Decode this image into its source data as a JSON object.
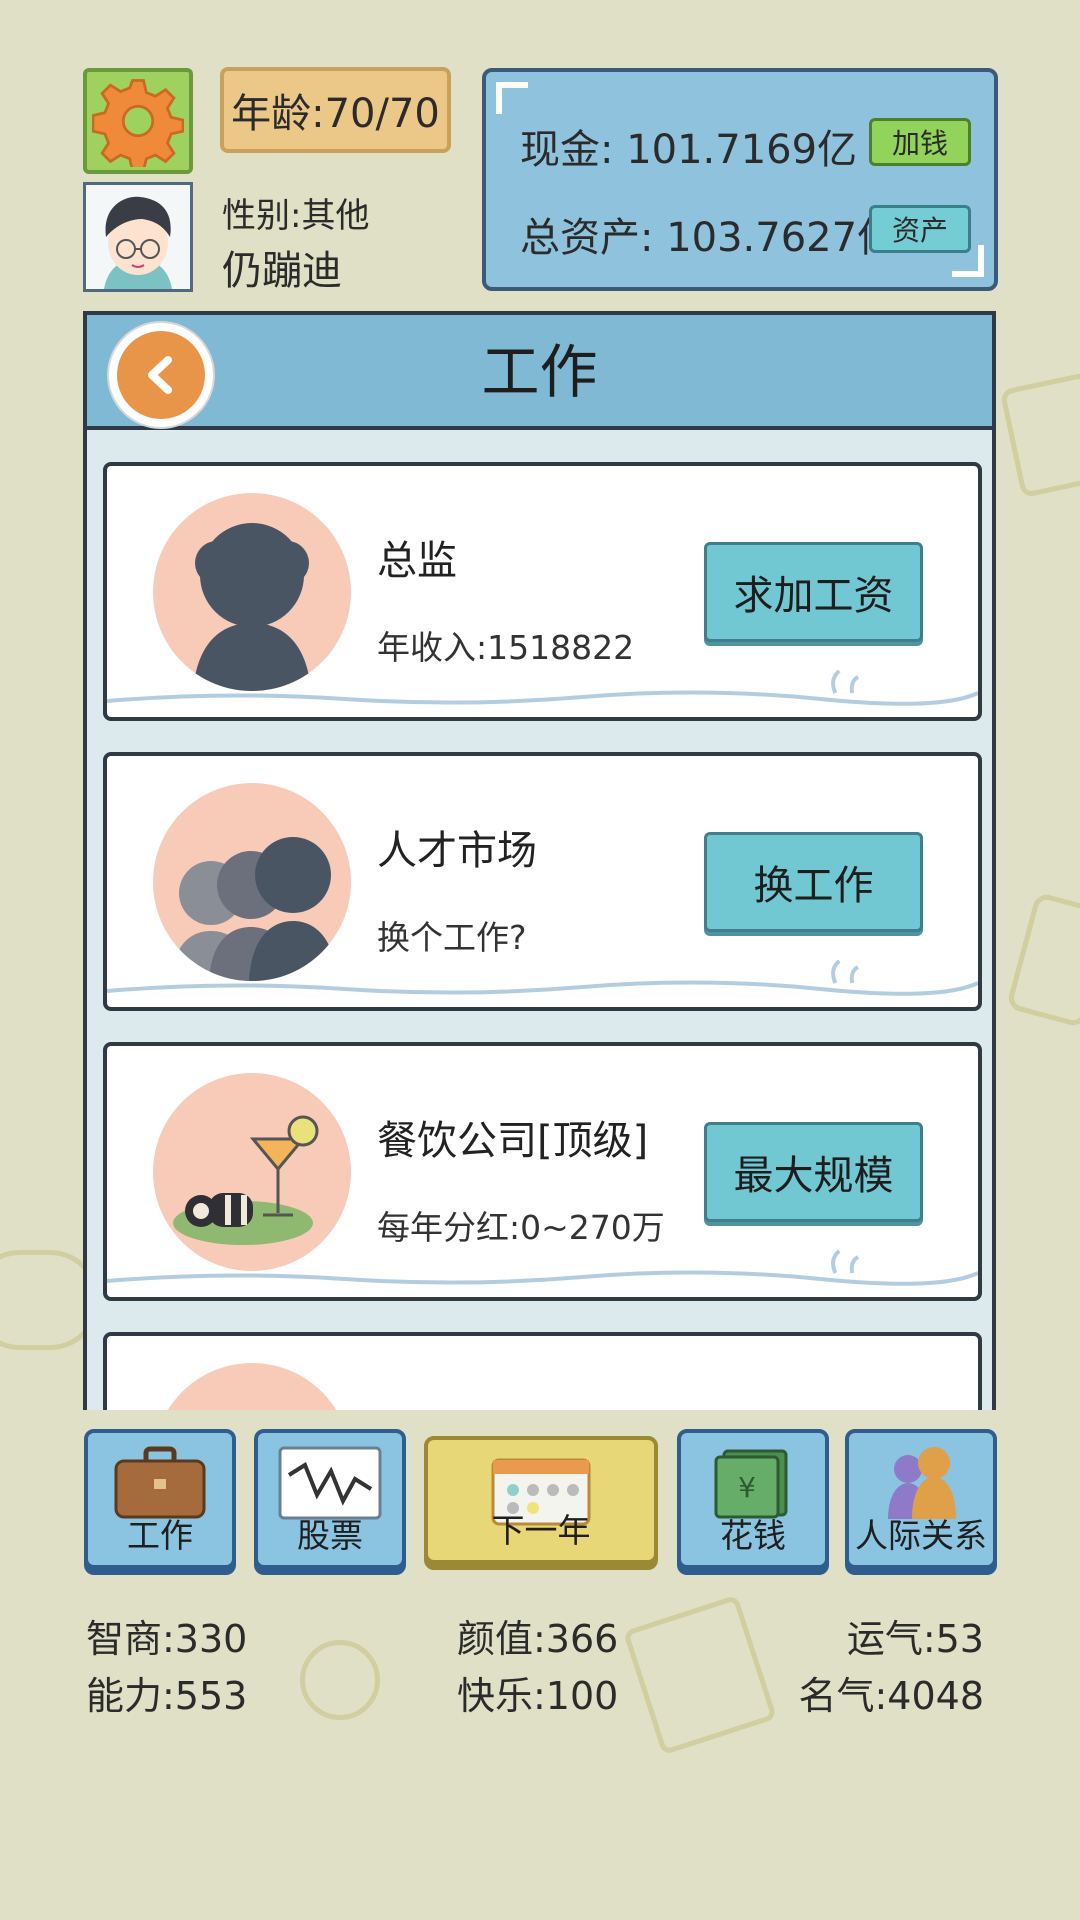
{
  "header": {
    "age": "年龄:70/70",
    "gender": "性别:其他",
    "name": "仍蹦迪",
    "cash": "现金: 101.7169亿",
    "total_assets": "总资产: 103.7627亿",
    "add_money_label": "加钱",
    "assets_label": "资产"
  },
  "panel": {
    "title": "工作",
    "cards": [
      {
        "title": "总监",
        "subtitle": "年收入:1518822",
        "button": "求加工资",
        "icon": "person-silhouette-icon"
      },
      {
        "title": "人才市场",
        "subtitle": "换个工作?",
        "button": "换工作",
        "icon": "people-group-icon"
      },
      {
        "title": "餐饮公司[顶级]",
        "subtitle": "每年分红:0~270万",
        "button": "最大规模",
        "icon": "cocktail-sushi-icon"
      }
    ]
  },
  "nav": {
    "work": "工作",
    "stocks": "股票",
    "next_year": "下一年",
    "spend": "花钱",
    "relations": "人际关系"
  },
  "stats": {
    "iq": "智商:330",
    "looks": "颜值:366",
    "luck": "运气:53",
    "ability": "能力:553",
    "happiness": "快乐:100",
    "fame": "名气:4048"
  },
  "colors": {
    "background": "#dfe0c5",
    "panel_blue": "#8ec2dd",
    "button_teal": "#72c8d2",
    "orange_accent": "#e8954a"
  }
}
